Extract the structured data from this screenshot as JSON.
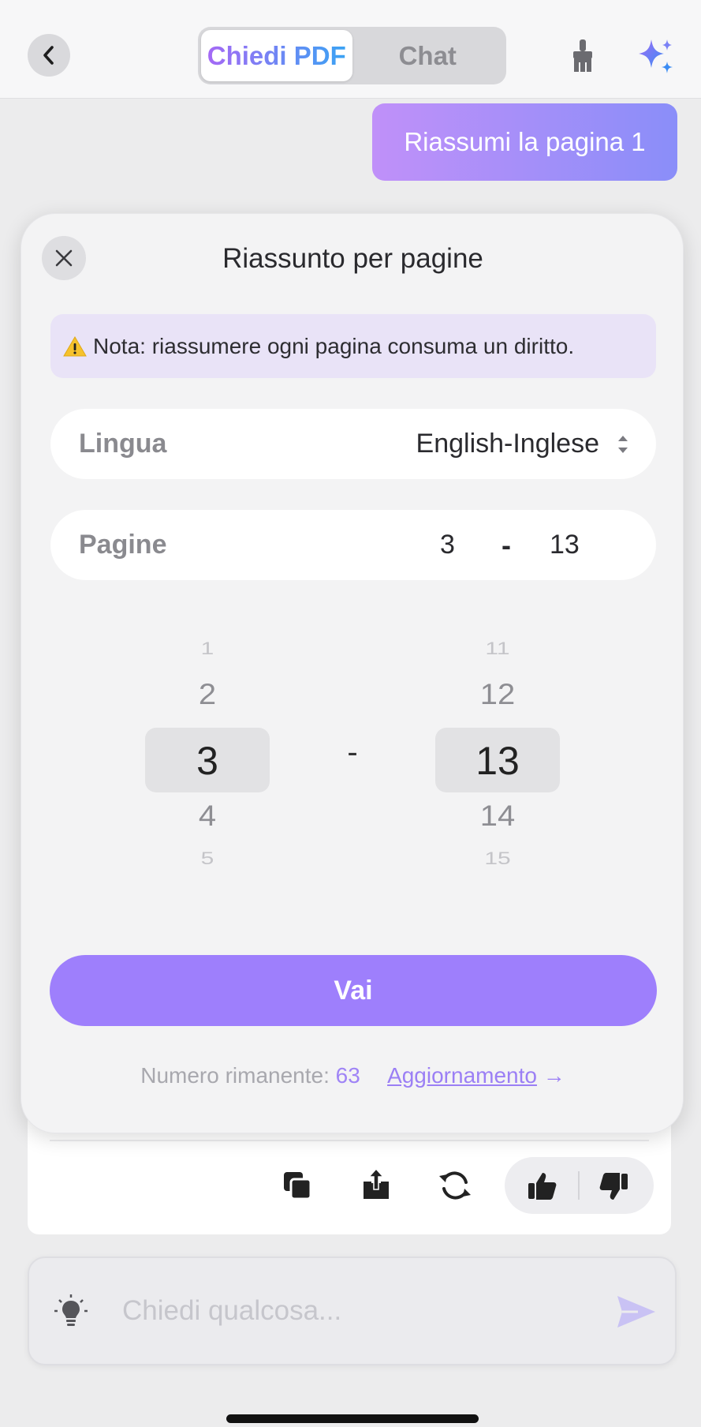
{
  "header": {
    "tabs": [
      {
        "label": "Chiedi PDF",
        "active": true
      },
      {
        "label": "Chat",
        "active": false
      }
    ],
    "icons": {
      "back": "chevron-left-icon",
      "clean": "brush-icon",
      "ai": "sparkle-icon"
    }
  },
  "chat": {
    "user_message": "Riassumi la pagina 1"
  },
  "modal": {
    "title": "Riassunto per pagine",
    "note": "Nota: riassumere ogni pagina consuma un diritto.",
    "language": {
      "label": "Lingua",
      "value": "English-Inglese"
    },
    "pages": {
      "label": "Pagine",
      "from": "3",
      "dash": "-",
      "to": "13"
    },
    "picker": {
      "from_values": [
        "1",
        "2",
        "3",
        "4",
        "5"
      ],
      "to_values": [
        "11",
        "12",
        "13",
        "14",
        "15"
      ],
      "selected_index": 2,
      "separator": "-"
    },
    "go_label": "Vai",
    "remaining_label": "Numero rimanente:",
    "remaining_count": "63",
    "upgrade_label": "Aggiornamento",
    "upgrade_arrow": "→"
  },
  "answer_actions": [
    "copy-icon",
    "share-icon",
    "regenerate-icon",
    "thumbs-up-icon",
    "thumbs-down-icon"
  ],
  "input": {
    "placeholder": "Chiedi qualcosa..."
  },
  "colors": {
    "accent": "#9e7ffc",
    "note_bg": "#e9e3f7",
    "bubble_start": "#c090f9",
    "bubble_end": "#8a8ef9"
  }
}
